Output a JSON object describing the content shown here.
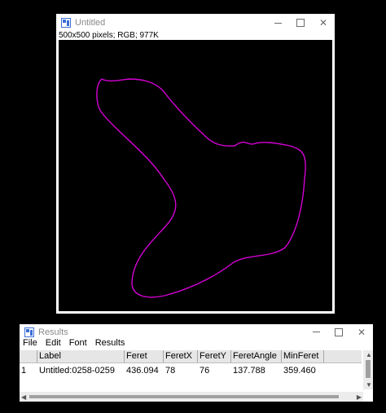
{
  "image_window": {
    "title": "Untitled",
    "info": "500x500 pixels; RGB; 977K",
    "shape_color": "#d400d4",
    "icons": [
      "imagej-app-icon",
      "minimize-icon",
      "maximize-icon",
      "close-icon"
    ]
  },
  "results_window": {
    "title": "Results",
    "menu": [
      "File",
      "Edit",
      "Font",
      "Results"
    ],
    "columns": [
      "",
      "Label",
      "Feret",
      "FeretX",
      "FeretY",
      "FeretAngle",
      "MinFeret"
    ],
    "rows": [
      {
        "index": "1",
        "label": "Untitled:0258-0259",
        "feret": "436.094",
        "feretx": "78",
        "ferety": "76",
        "feretangle": "137.788",
        "minferet": "359.460"
      }
    ],
    "icons": [
      "imagej-app-icon",
      "minimize-icon",
      "maximize-icon",
      "close-icon",
      "scroll-up-icon",
      "scroll-down-icon",
      "scroll-left-icon",
      "scroll-right-icon"
    ]
  }
}
